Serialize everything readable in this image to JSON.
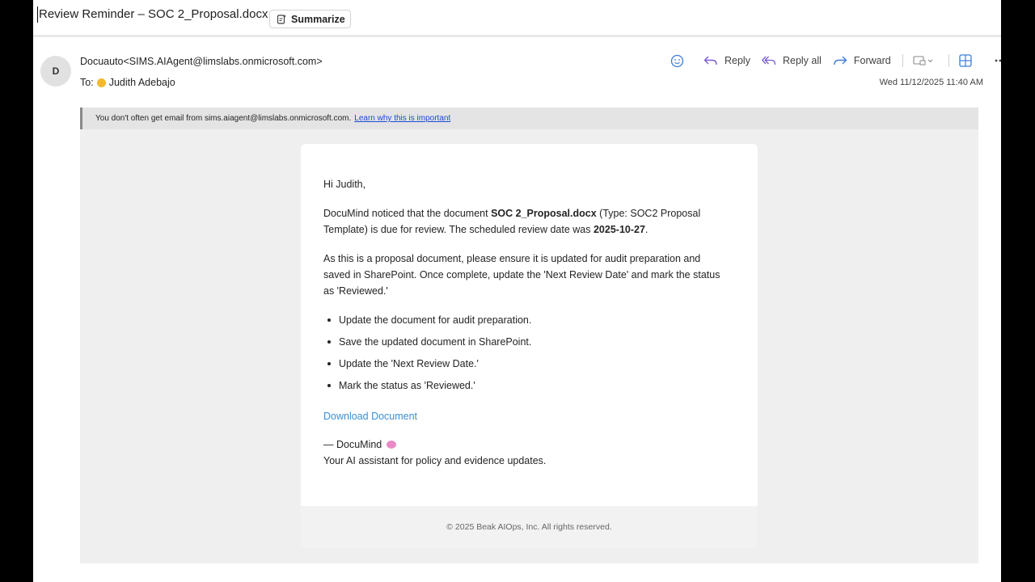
{
  "subject": "Review Reminder – SOC 2_Proposal.docx",
  "summarize_label": "Summarize",
  "sender": {
    "avatar_initial": "D",
    "from": "Docuauto<SIMS.AIAgent@limslabs.onmicrosoft.com>",
    "to_prefix": "To:",
    "to_name": "Judith Adebajo"
  },
  "actions": {
    "reply": "Reply",
    "reply_all": "Reply all",
    "forward": "Forward"
  },
  "date": "Wed 11/12/2025 11:40 AM",
  "banner": {
    "text": "You don't often get email from sims.aiagent@limslabs.onmicrosoft.com.",
    "link": "Learn why this is important"
  },
  "email": {
    "greeting": "Hi Judith,",
    "p1_a": "DocuMind noticed that the document ",
    "p1_doc": "SOC 2_Proposal.docx",
    "p1_b": " (Type: SOC2 Proposal Template) is due for review. The scheduled review date was ",
    "p1_date": "2025-10-27",
    "p1_c": ".",
    "p2": "As this is a proposal document, please ensure it is updated for audit preparation and saved in SharePoint. Once complete, update the 'Next Review Date' and mark the status as 'Reviewed.'",
    "bullets": [
      "Update the document for audit preparation.",
      "Save the updated document in SharePoint.",
      "Update the 'Next Review Date.'",
      "Mark the status as 'Reviewed.'"
    ],
    "download_link": "Download Document",
    "signature": "— DocuMind",
    "tagline": "Your AI assistant for policy and evidence updates.",
    "footer": "© 2025 Beak AIOps, Inc. All rights reserved."
  },
  "colors": {
    "link_blue": "#1a4ad6",
    "download_blue": "#3a8fd6",
    "icon_blue": "#3b7dd8",
    "icon_purple": "#7a5ccf"
  }
}
